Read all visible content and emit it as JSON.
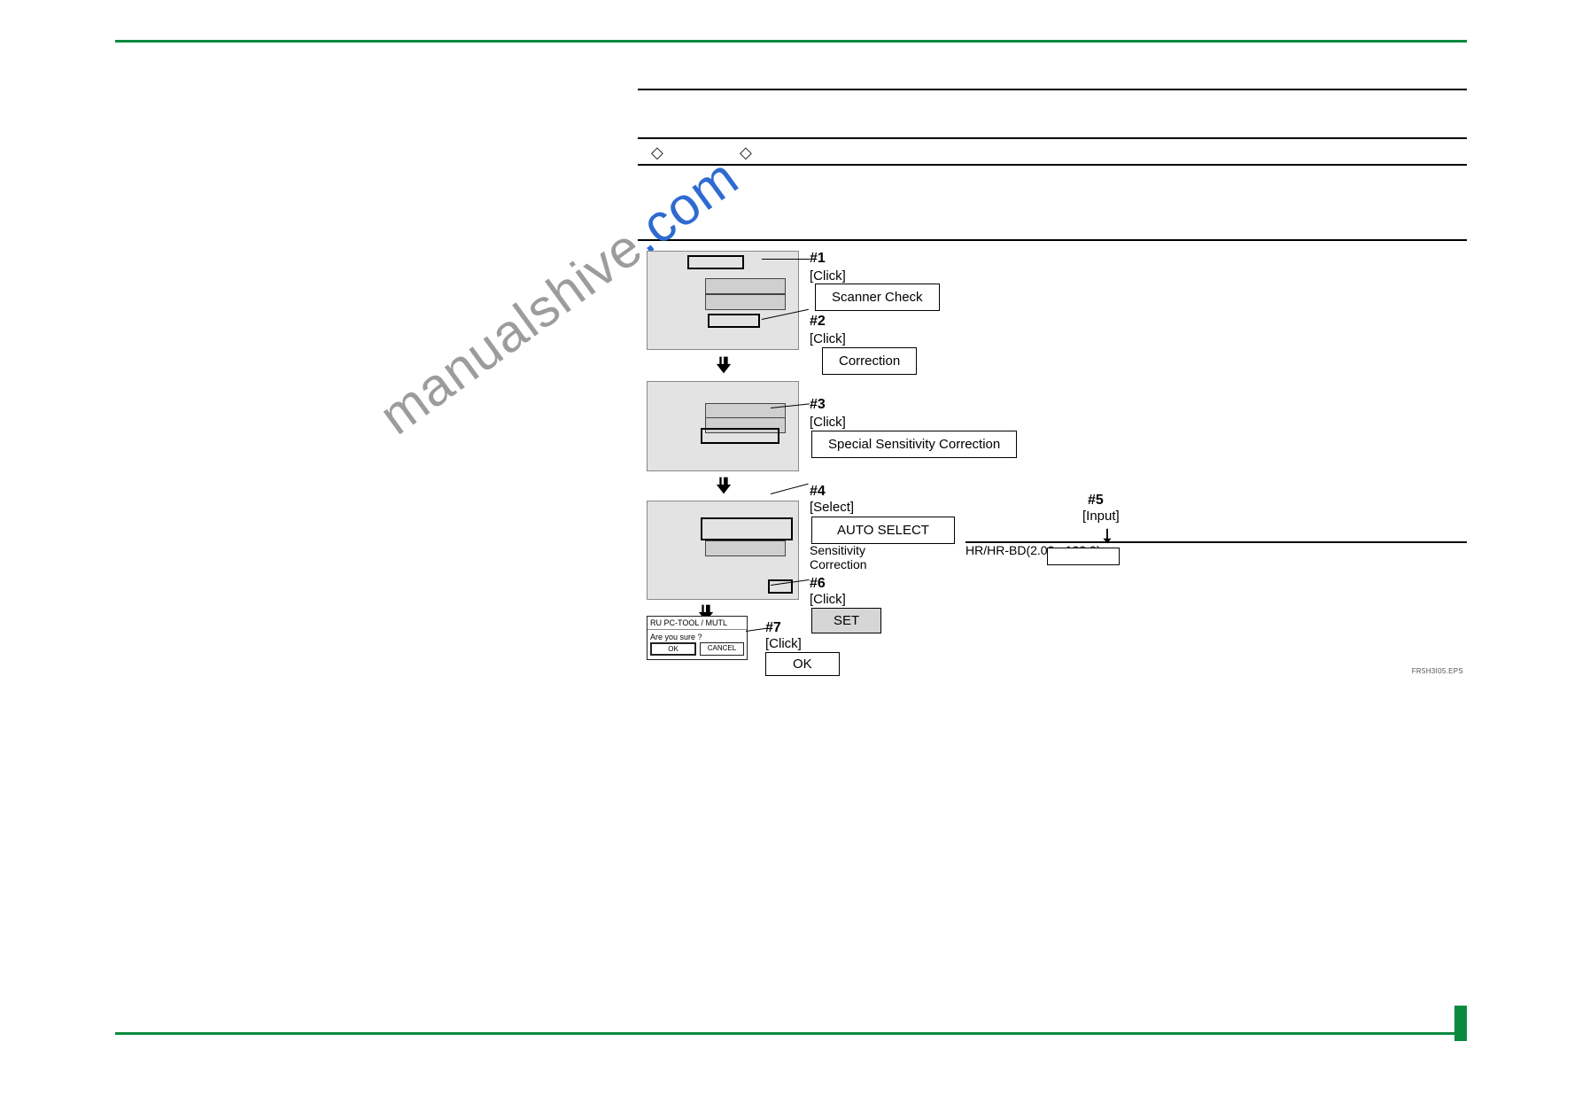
{
  "watermark": {
    "part1": "manualshive",
    "part2": ".com"
  },
  "ep_label": "FR5H3I05.EPS",
  "steps": {
    "s1": {
      "tag": "#1",
      "action": "[Click]",
      "button": "Scanner Check"
    },
    "s2": {
      "tag": "#2",
      "action": "[Click]",
      "button": "Correction"
    },
    "s3": {
      "tag": "#3",
      "action": "[Click]",
      "button": "Special Sensitivity Correction"
    },
    "s4": {
      "tag": "#4",
      "action": "[Select]",
      "button": "AUTO SELECT",
      "sublabel": "Sensitivity\nCorrection"
    },
    "s5": {
      "tag": "#5",
      "action": "[Input]",
      "range": "HR/HR-BD(2.00 - 199.0)"
    },
    "s6": {
      "tag": "#6",
      "action": "[Click]",
      "button": "SET"
    },
    "s7": {
      "tag": "#7",
      "action": "[Click]",
      "button": "OK"
    }
  },
  "dialog": {
    "title": "RU PC-TOOL / MUTL",
    "msg": "Are you sure ?",
    "ok": "OK",
    "cancel": "CANCEL"
  }
}
